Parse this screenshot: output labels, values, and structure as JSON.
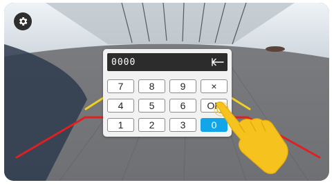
{
  "screen": {
    "mode": "rear camera view"
  },
  "toolbar": {
    "settings_icon": "gear-icon"
  },
  "keypad": {
    "pin_value": "0000",
    "backspace_icon": "backspace-arrow-icon",
    "rows": [
      [
        "7",
        "8",
        "9",
        "×"
      ],
      [
        "4",
        "5",
        "6",
        "OK"
      ],
      [
        "1",
        "2",
        "3",
        "0"
      ]
    ]
  },
  "guide_lines": {
    "near": "#e02020",
    "mid": "#f0d020"
  },
  "colors": {
    "accent": "#12a6e8",
    "hand": "#f5c21e"
  }
}
